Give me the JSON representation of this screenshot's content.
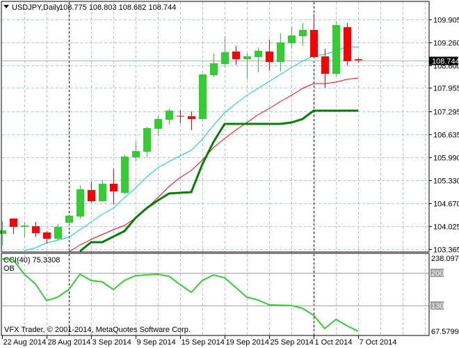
{
  "header": {
    "menu_icon": "triangle-down-icon",
    "symbol_label": "USDJPY,Daily",
    "ohlc_readout": "108.775 108.803 108.682 108.744"
  },
  "indicator": {
    "label": "CCI(40) 75.3308",
    "level_tag": "OB"
  },
  "copyright": "VFX Trader, © 2001-2014, MetaQuotes Software Corp.",
  "colors": {
    "bull": "#32cd32",
    "bear": "#ff0000",
    "ma_fast": "#00ced1",
    "ma_mid": "#ff0000",
    "ma_slow": "#008000",
    "cci": "#32cd32",
    "grid": "#b0c4de",
    "period_separator": "#000000",
    "level_line": "#a0a0a0",
    "bid_line": "#a0b4d0"
  },
  "chart_data": [
    {
      "type": "candlestick",
      "title": "USDJPY,Daily",
      "grid": true,
      "ylim": [
        103.365,
        109.905
      ],
      "y_ticks": [
        "109.905",
        "109.260",
        "108.600",
        "107.955",
        "107.295",
        "106.635",
        "105.990",
        "105.330",
        "104.670",
        "104.025",
        "103.365"
      ],
      "y_tick_values": [
        109.905,
        109.26,
        108.6,
        107.955,
        107.295,
        106.635,
        105.99,
        105.33,
        104.67,
        104.025,
        103.365
      ],
      "current_price": "108.744",
      "x_ticks": [
        {
          "index": 0,
          "label": "22 Aug 2014"
        },
        {
          "index": 4,
          "label": "28 Aug 2014"
        },
        {
          "index": 8,
          "label": "3 Sep 2014"
        },
        {
          "index": 12,
          "label": "9 Sep 2014"
        },
        {
          "index": 16,
          "label": "15 Sep 2014"
        },
        {
          "index": 20,
          "label": "19 Sep 2014"
        },
        {
          "index": 24,
          "label": "25 Sep 2014"
        },
        {
          "index": 28,
          "label": "1 Oct 2014"
        },
        {
          "index": 32,
          "label": "7 Oct 2014"
        }
      ],
      "period_separators": [
        "1 Sep 2014",
        "1 Oct 2014"
      ],
      "dates": [
        "22 Aug",
        "25 Aug",
        "26 Aug",
        "27 Aug",
        "28 Aug",
        "29 Aug",
        "1 Sep",
        "2 Sep",
        "3 Sep",
        "4 Sep",
        "5 Sep",
        "8 Sep",
        "9 Sep",
        "10 Sep",
        "11 Sep",
        "12 Sep",
        "15 Sep",
        "16 Sep",
        "17 Sep",
        "18 Sep",
        "19 Sep",
        "22 Sep",
        "23 Sep",
        "24 Sep",
        "25 Sep",
        "26 Sep",
        "29 Sep",
        "30 Sep",
        "1 Oct",
        "2 Oct",
        "3 Oct",
        "6 Oct",
        "7 Oct"
      ],
      "ohlc": [
        [
          103.801,
          104.157,
          103.464,
          103.9
        ],
        [
          104.237,
          104.237,
          103.801,
          103.999
        ],
        [
          103.999,
          104.137,
          103.702,
          104.038
        ],
        [
          104.019,
          104.137,
          103.722,
          103.821
        ],
        [
          103.841,
          103.88,
          103.524,
          103.662
        ],
        [
          103.662,
          104.078,
          103.623,
          103.999
        ],
        [
          104.118,
          104.316,
          104.058,
          104.316
        ],
        [
          104.296,
          105.188,
          104.237,
          105.069
        ],
        [
          105.049,
          105.287,
          104.692,
          104.732
        ],
        [
          104.732,
          105.326,
          104.712,
          105.228
        ],
        [
          105.228,
          105.664,
          104.633,
          105.01
        ],
        [
          104.97,
          106.06,
          104.93,
          106.001
        ],
        [
          105.981,
          106.437,
          105.862,
          106.159
        ],
        [
          106.139,
          106.853,
          105.981,
          106.813
        ],
        [
          106.793,
          107.17,
          106.595,
          107.071
        ],
        [
          107.051,
          107.368,
          106.912,
          107.309
        ],
        [
          107.16,
          107.328,
          106.952,
          107.15
        ],
        [
          107.15,
          107.289,
          106.754,
          107.071
        ],
        [
          107.071,
          108.359,
          107.051,
          108.339
        ],
        [
          108.319,
          108.934,
          108.26,
          108.656
        ],
        [
          108.637,
          109.429,
          108.537,
          108.973
        ],
        [
          108.993,
          109.152,
          108.617,
          108.775
        ],
        [
          108.775,
          108.954,
          108.2,
          108.855
        ],
        [
          108.835,
          109.112,
          108.399,
          109.013
        ],
        [
          108.993,
          109.33,
          108.458,
          108.696
        ],
        [
          108.696,
          109.509,
          108.419,
          109.251
        ],
        [
          109.231,
          109.707,
          109.073,
          109.449
        ],
        [
          109.429,
          109.806,
          109.152,
          109.608
        ],
        [
          109.608,
          110.064,
          108.835,
          108.835
        ],
        [
          108.855,
          109.073,
          107.963,
          108.359
        ],
        [
          108.359,
          109.865,
          108.3,
          109.746
        ],
        [
          109.687,
          109.806,
          108.597,
          108.716
        ],
        [
          108.775,
          108.803,
          108.682,
          108.744
        ]
      ],
      "overlays": [
        {
          "color_key": "ma_fast",
          "values": [
            null,
            null,
            103.325,
            103.404,
            103.543,
            103.622,
            103.701,
            103.919,
            104.137,
            104.355,
            104.534,
            104.831,
            105.109,
            105.426,
            105.683,
            105.862,
            106.02,
            106.179,
            106.496,
            106.892,
            107.249,
            107.507,
            107.745,
            107.943,
            108.141,
            108.339,
            108.537,
            108.716,
            108.874,
            108.914,
            109.013,
            109.132,
            109.112
          ]
        },
        {
          "color_key": "ma_mid",
          "values": [
            null,
            null,
            null,
            null,
            null,
            null,
            103.285,
            103.483,
            103.642,
            103.781,
            103.919,
            104.038,
            104.256,
            104.534,
            104.831,
            105.148,
            105.406,
            105.604,
            105.901,
            106.258,
            106.516,
            106.754,
            106.972,
            107.19,
            107.368,
            107.566,
            107.745,
            107.943,
            108.082,
            108.082,
            108.121,
            108.2,
            108.24
          ]
        },
        {
          "color_key": "ma_slow",
          "values": [
            null,
            null,
            null,
            null,
            null,
            null,
            null,
            103.305,
            103.563,
            103.563,
            103.721,
            103.88,
            104.256,
            104.534,
            104.752,
            104.95,
            104.97,
            104.99,
            105.782,
            106.417,
            106.932,
            106.932,
            106.932,
            106.932,
            106.932,
            106.932,
            106.972,
            107.071,
            107.309,
            107.309,
            107.309,
            107.309,
            107.309
          ]
        }
      ]
    },
    {
      "type": "line",
      "title": "CCI(40) 75.3308",
      "ylim": [
        67.5799,
        238.0978
      ],
      "y_tick_labels": [
        "238.0978",
        "67.5799"
      ],
      "levels": [
        {
          "value": 200,
          "label": "200"
        },
        {
          "value": 130,
          "label": "130"
        }
      ],
      "values": [
        229.1,
        227.7,
        196.6,
        175.9,
        140.4,
        147.8,
        164.1,
        196.6,
        183.3,
        180.3,
        164.1,
        183.3,
        193.6,
        195.1,
        196.6,
        192.2,
        174.4,
        158.1,
        183.3,
        195.1,
        189.2,
        168.5,
        147.8,
        141.9,
        131.5,
        130.8,
        130.0,
        124.1,
        109.3,
        81.2,
        100.4,
        87.1,
        75.33
      ]
    }
  ]
}
